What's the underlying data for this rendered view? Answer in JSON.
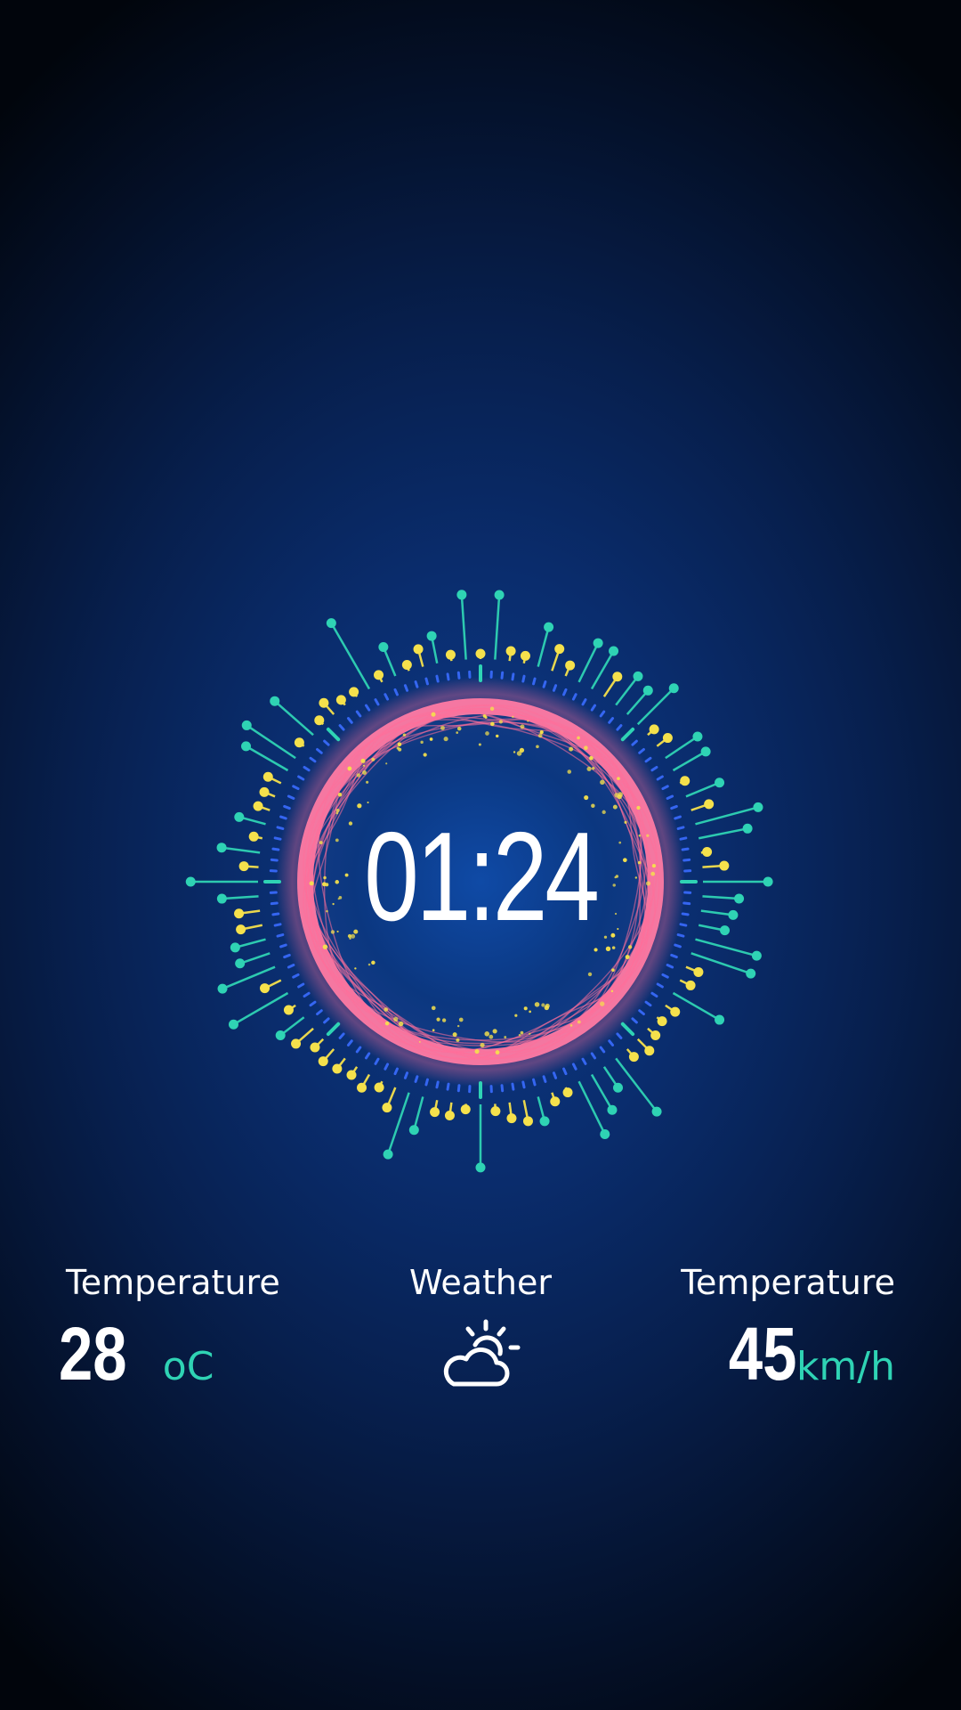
{
  "clock": {
    "time": "01:24"
  },
  "stats": [
    {
      "label": "Temperature",
      "value": "28",
      "unit": "oC"
    },
    {
      "label": "Weather",
      "icon": "partly-cloudy-icon"
    },
    {
      "label": "Temperature",
      "value": "45",
      "unit": "km/h"
    }
  ],
  "colors": {
    "accent": "#2fd3b4",
    "ring": "#ff6f9a",
    "spark": "#f5e14c",
    "tick": "#3a6cff",
    "background": "#0a2d6e"
  }
}
